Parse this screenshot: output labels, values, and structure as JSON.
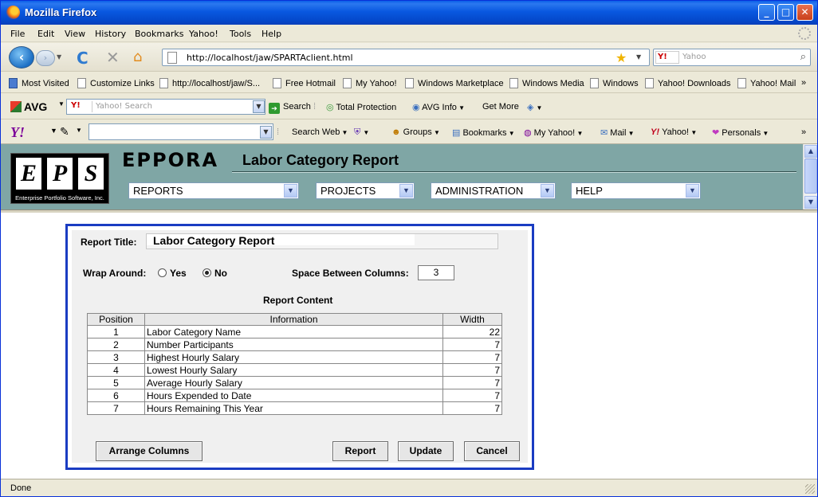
{
  "window": {
    "title": "Mozilla Firefox"
  },
  "menu": [
    "File",
    "Edit",
    "View",
    "History",
    "Bookmarks",
    "Yahoo!",
    "Tools",
    "Help"
  ],
  "nav": {
    "url": "http://localhost/jaw/SPARTAclient.html",
    "search_placeholder": "Yahoo",
    "search_engine": "Y!"
  },
  "bookmarks": [
    "Most Visited",
    "Customize Links",
    "http://localhost/jaw/S...",
    "Free Hotmail",
    "My Yahoo!",
    "Windows Marketplace",
    "Windows Media",
    "Windows",
    "Yahoo! Downloads",
    "Yahoo! Mail"
  ],
  "bookmarks_overflow": "»",
  "avg_toolbar": {
    "logo": "AVG",
    "search_placeholder": "Yahoo! Search",
    "engine": "Y!",
    "search_label": "Search",
    "total_protection": "Total Protection",
    "avg_info": "AVG Info",
    "get_more": "Get More"
  },
  "yahoo_toolbar": {
    "logo": "Y!",
    "search_web": "Search Web",
    "groups": "Groups",
    "bookmarks": "Bookmarks",
    "my_yahoo": "My Yahoo!",
    "mail": "Mail",
    "yahoo": "Yahoo!",
    "personals": "Personals",
    "overflow": "»"
  },
  "app": {
    "logo_letters": [
      "E",
      "P",
      "S"
    ],
    "logo_tagline": "Enterprise Portfolio Software, Inc.",
    "name": "EPPORA",
    "subtitle": "Labor Category Report",
    "menus": [
      "REPORTS",
      "PROJECTS",
      "ADMINISTRATION",
      "HELP"
    ]
  },
  "report": {
    "title_label": "Report Title:",
    "title_value": "Labor Category Report",
    "wrap_label": "Wrap Around:",
    "wrap_yes": "Yes",
    "wrap_no": "No",
    "wrap_selected": "No",
    "space_label": "Space Between Columns:",
    "space_value": "3",
    "content_heading": "Report Content",
    "columns": [
      "Position",
      "Information",
      "Width"
    ],
    "rows": [
      [
        "1",
        "Labor Category Name",
        "22"
      ],
      [
        "2",
        "Number Participants",
        "7"
      ],
      [
        "3",
        "Highest Hourly Salary",
        "7"
      ],
      [
        "4",
        "Lowest Hourly Salary",
        "7"
      ],
      [
        "5",
        "Average Hourly Salary",
        "7"
      ],
      [
        "6",
        "Hours Expended to Date",
        "7"
      ],
      [
        "7",
        "Hours Remaining This Year",
        "7"
      ]
    ],
    "buttons": {
      "arrange": "Arrange Columns",
      "report": "Report",
      "update": "Update",
      "cancel": "Cancel"
    }
  },
  "status": "Done"
}
